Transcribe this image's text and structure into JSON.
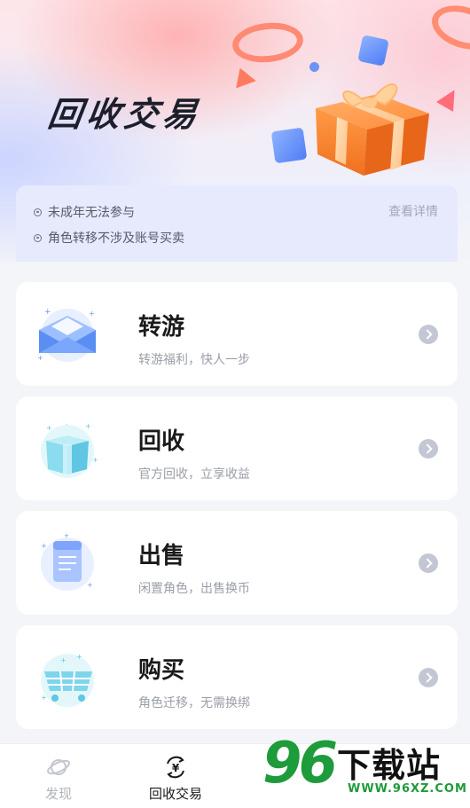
{
  "banner": {
    "title": "回收交易"
  },
  "notice": {
    "lines": [
      "未成年无法参与",
      "角色转移不涉及账号买卖"
    ],
    "detail_link": "查看详情"
  },
  "services": [
    {
      "title": "转游",
      "subtitle": "转游福利，快人一步",
      "icon": "envelope-icon"
    },
    {
      "title": "回收",
      "subtitle": "官方回收，立享收益",
      "icon": "open-box-icon"
    },
    {
      "title": "出售",
      "subtitle": "闲置角色，出售换币",
      "icon": "document-icon"
    },
    {
      "title": "购买",
      "subtitle": "角色迁移，无需换绑",
      "icon": "shopping-cart-icon"
    }
  ],
  "tabbar": {
    "tabs": [
      {
        "label": "发现",
        "icon": "planet-icon",
        "active": false
      },
      {
        "label": "回收交易",
        "icon": "yuan-cycle-icon",
        "active": true
      }
    ]
  },
  "watermark": {
    "number": "96",
    "site_name": "下载站",
    "url": "WWW.96XZ.COM"
  },
  "colors": {
    "accent": "#4f7ef5",
    "primary_text": "#1a1a1a",
    "secondary_text": "#9a9ea8",
    "watermark_green": "#1e9b3a"
  }
}
